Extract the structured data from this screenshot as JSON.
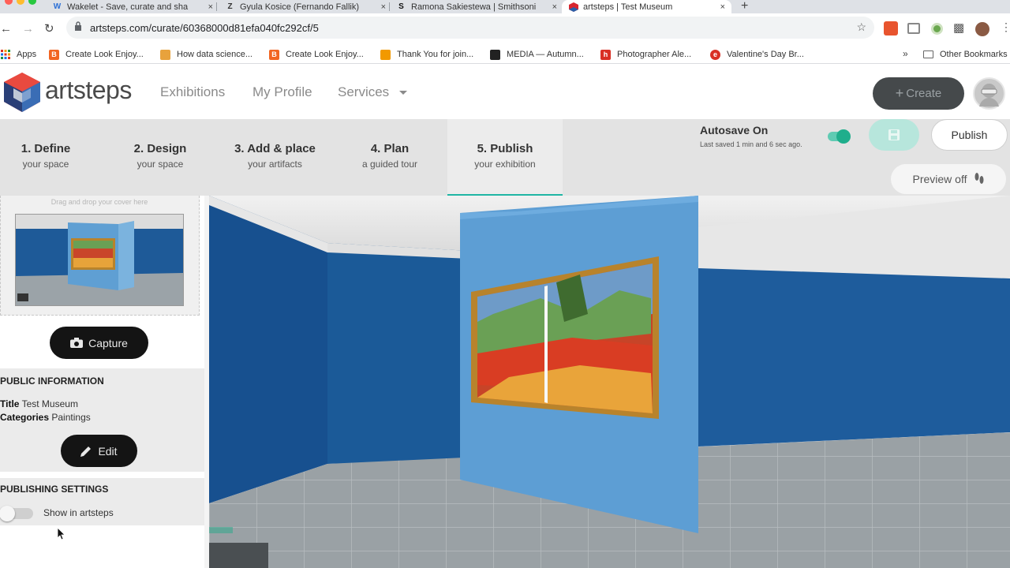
{
  "browser": {
    "tabs": [
      {
        "title": "Wakelet - Save, curate and sha",
        "icon": "wakelet-icon",
        "fav": "W"
      },
      {
        "title": "Gyula Kosice (Fernando Fallik)",
        "icon": "zigzag-icon",
        "fav": "Z"
      },
      {
        "title": "Ramona Sakiestewa | Smithsoni",
        "icon": "smithsonian-icon",
        "fav": "S"
      },
      {
        "title": "artsteps | Test Museum",
        "icon": "artsteps-icon",
        "fav": ""
      }
    ],
    "new_tab": "+",
    "close_glyph": "×",
    "url": "artsteps.com/curate/60368000d81efa040fc292cf/5",
    "bookmarks": [
      {
        "label": "Apps",
        "color": "#4285f4"
      },
      {
        "label": "Create Look Enjoy...",
        "color": "#f26522"
      },
      {
        "label": "How data science...",
        "color": "#e8a23c"
      },
      {
        "label": "Create Look Enjoy...",
        "color": "#f26522"
      },
      {
        "label": "Thank You for join...",
        "color": "#f29900"
      },
      {
        "label": "MEDIA — Autumn...",
        "color": "#222222"
      },
      {
        "label": "Photographer Ale...",
        "color": "#d93025"
      },
      {
        "label": "Valentine's Day Br...",
        "color": "#d93025"
      }
    ],
    "more_bookmarks": "»",
    "other_bookmarks": "Other Bookmarks"
  },
  "site": {
    "logo_text": "artsteps",
    "nav": [
      "Exhibitions",
      "My Profile",
      "Services"
    ],
    "create_label": "Create",
    "create_plus": "+"
  },
  "steps": [
    {
      "number": "1. Define",
      "sub": "your space"
    },
    {
      "number": "2. Design",
      "sub": "your space"
    },
    {
      "number": "3. Add & place",
      "sub": "your artifacts"
    },
    {
      "number": "4. Plan",
      "sub": "a guided tour"
    },
    {
      "number": "5. Publish",
      "sub": "your exhibition"
    }
  ],
  "autosave": {
    "title": "Autosave On",
    "subtitle": "Last saved 1 min and 6 sec ago.",
    "enabled": true
  },
  "publish_label": "Publish",
  "preview_label": "Preview off",
  "left": {
    "cover_hint": "Drag and drop your cover here",
    "capture_label": "Capture",
    "public_info": {
      "heading": "PUBLIC INFORMATION",
      "title_key": "Title",
      "title_value": "Test Museum",
      "categories_key": "Categories",
      "categories_value": "Paintings"
    },
    "edit_label": "Edit",
    "publishing": {
      "heading": "PUBLISHING SETTINGS",
      "show_label": "Show in artsteps",
      "show_enabled": false
    }
  },
  "colors": {
    "accent": "#1fb6a4",
    "wall_blue": "#1d5a97",
    "panel_blue": "#5f9fd3",
    "frame_gold": "#b8832c"
  }
}
